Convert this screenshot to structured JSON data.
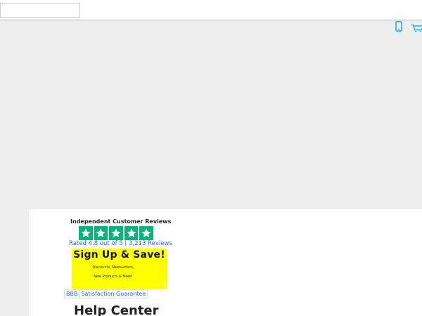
{
  "search": {
    "placeholder": "",
    "value": ""
  },
  "header_icons": [
    "phone-icon",
    "cart-icon"
  ],
  "colors": {
    "accent": "#1faee9",
    "star_bg": "#00b67a",
    "link": "#3366cc",
    "banner_bg": "#ffff00"
  },
  "reviews": {
    "title": "Independent Customer Reviews",
    "star_count": 5,
    "rating_label": "Rated 4.8 out of 5 |",
    "reviews_link": "3,213 Reviews"
  },
  "signup": {
    "headline": "Sign Up & Save!",
    "line1": "Discounts, Newsletters,",
    "line2": "New Products & More!"
  },
  "guarantee": {
    "bbb": "BBB",
    "satisfaction": "Satisfaction Guarantee"
  },
  "page_title": "Help Center"
}
